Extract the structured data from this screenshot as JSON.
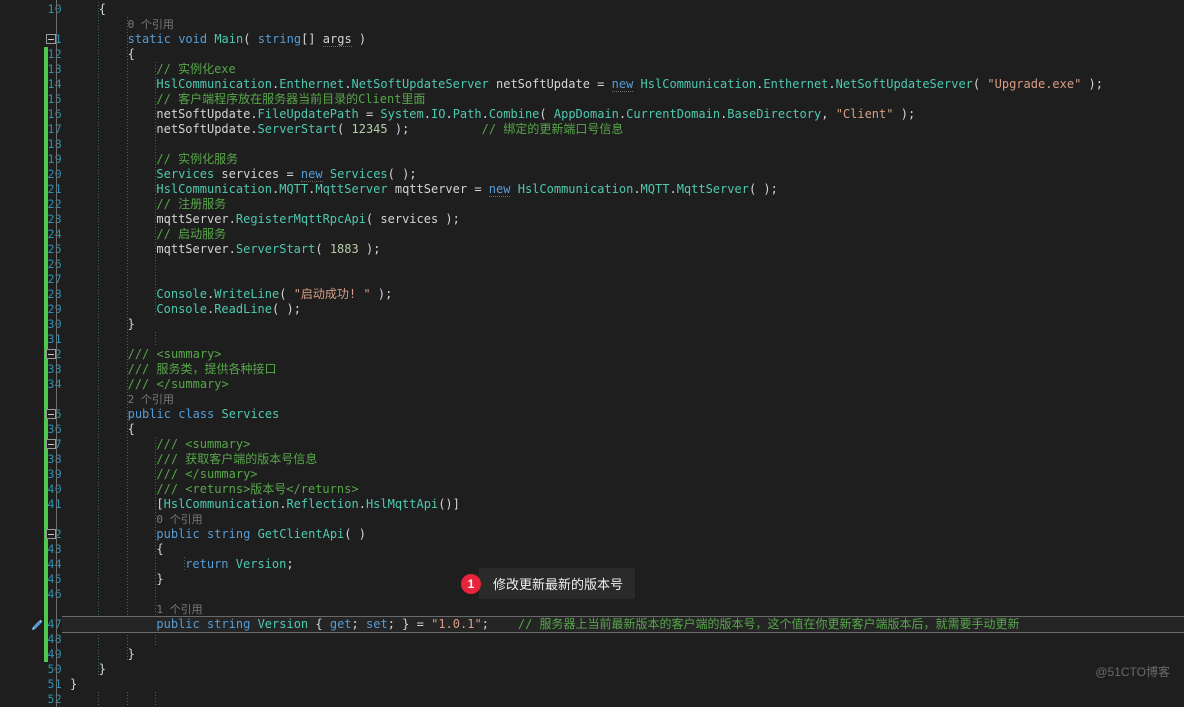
{
  "editor": {
    "name": "visual-studio-code-editor",
    "theme": "dark",
    "background_color": "#1e1e1e",
    "line_number_color": "#2b91af",
    "change_bar_color": "#4ec94e",
    "first_line": 10,
    "last_line": 52,
    "line_height": 15
  },
  "watermark": {
    "text": "@51CTO博客"
  },
  "annotation": {
    "badge": "1",
    "text": "修改更新最新的版本号"
  },
  "gutter": {
    "line_numbers": [
      10,
      11,
      12,
      13,
      14,
      15,
      16,
      17,
      18,
      19,
      20,
      21,
      22,
      23,
      24,
      25,
      26,
      27,
      28,
      29,
      30,
      31,
      32,
      33,
      34,
      35,
      36,
      37,
      38,
      39,
      40,
      41,
      42,
      43,
      44,
      45,
      46,
      47,
      48,
      49,
      50,
      51,
      52
    ],
    "fold_lines": [
      11,
      32,
      35,
      37,
      42
    ],
    "pencil_icon_line": 47
  },
  "code": {
    "lines": [
      {
        "n": 10,
        "indent": 4,
        "text": "{"
      },
      {
        "n": null,
        "indent": 8,
        "text": "0 个引用",
        "kind": "codelens"
      },
      {
        "n": 11,
        "indent": 8,
        "text": "static void Main( string[] args )"
      },
      {
        "n": 12,
        "indent": 8,
        "text": "{"
      },
      {
        "n": 13,
        "indent": 12,
        "text": "// 实例化exe"
      },
      {
        "n": 14,
        "indent": 12,
        "text": "HslCommunication.Enthernet.NetSoftUpdateServer netSoftUpdate = new HslCommunication.Enthernet.NetSoftUpdateServer( \"Upgrade.exe\" );"
      },
      {
        "n": 15,
        "indent": 12,
        "text": "// 客户端程序放在服务器当前目录的Client里面"
      },
      {
        "n": 16,
        "indent": 12,
        "text": "netSoftUpdate.FileUpdatePath = System.IO.Path.Combine( AppDomain.CurrentDomain.BaseDirectory, \"Client\" );"
      },
      {
        "n": 17,
        "indent": 12,
        "text": "netSoftUpdate.ServerStart( 12345 );          // 绑定的更新端口号信息"
      },
      {
        "n": 18,
        "indent": 12,
        "text": ""
      },
      {
        "n": 19,
        "indent": 12,
        "text": "// 实例化服务"
      },
      {
        "n": 20,
        "indent": 12,
        "text": "Services services = new Services( );"
      },
      {
        "n": 21,
        "indent": 12,
        "text": "HslCommunication.MQTT.MqttServer mqttServer = new HslCommunication.MQTT.MqttServer( );"
      },
      {
        "n": 22,
        "indent": 12,
        "text": "// 注册服务"
      },
      {
        "n": 23,
        "indent": 12,
        "text": "mqttServer.RegisterMqttRpcApi( services );"
      },
      {
        "n": 24,
        "indent": 12,
        "text": "// 启动服务"
      },
      {
        "n": 25,
        "indent": 12,
        "text": "mqttServer.ServerStart( 1883 );"
      },
      {
        "n": 26,
        "indent": 12,
        "text": ""
      },
      {
        "n": 27,
        "indent": 12,
        "text": ""
      },
      {
        "n": 28,
        "indent": 12,
        "text": "Console.WriteLine( \"启动成功! \" );"
      },
      {
        "n": 29,
        "indent": 12,
        "text": "Console.ReadLine( );"
      },
      {
        "n": 30,
        "indent": 8,
        "text": "}"
      },
      {
        "n": 31,
        "indent": 8,
        "text": ""
      },
      {
        "n": 32,
        "indent": 8,
        "text": "/// <summary>"
      },
      {
        "n": 33,
        "indent": 8,
        "text": "/// 服务类，提供各种接口"
      },
      {
        "n": 34,
        "indent": 8,
        "text": "/// </summary>"
      },
      {
        "n": null,
        "indent": 8,
        "text": "2 个引用",
        "kind": "codelens"
      },
      {
        "n": 35,
        "indent": 8,
        "text": "public class Services"
      },
      {
        "n": 36,
        "indent": 8,
        "text": "{"
      },
      {
        "n": 37,
        "indent": 12,
        "text": "/// <summary>"
      },
      {
        "n": 38,
        "indent": 12,
        "text": "/// 获取客户端的版本号信息"
      },
      {
        "n": 39,
        "indent": 12,
        "text": "/// </summary>"
      },
      {
        "n": 40,
        "indent": 12,
        "text": "/// <returns>版本号</returns>"
      },
      {
        "n": 41,
        "indent": 12,
        "text": "[HslCommunication.Reflection.HslMqttApi()]"
      },
      {
        "n": null,
        "indent": 12,
        "text": "0 个引用",
        "kind": "codelens"
      },
      {
        "n": 42,
        "indent": 12,
        "text": "public string GetClientApi( )"
      },
      {
        "n": 43,
        "indent": 12,
        "text": "{"
      },
      {
        "n": 44,
        "indent": 16,
        "text": "return Version;"
      },
      {
        "n": 45,
        "indent": 12,
        "text": "}"
      },
      {
        "n": 46,
        "indent": 12,
        "text": ""
      },
      {
        "n": null,
        "indent": 12,
        "text": "1 个引用",
        "kind": "codelens"
      },
      {
        "n": 47,
        "indent": 12,
        "text": "public string Version { get; set; } = \"1.0.1\";    // 服务器上当前最新版本的客户端的版本号，这个值在你更新客户端版本后，就需要手动更新"
      },
      {
        "n": 48,
        "indent": 12,
        "text": ""
      },
      {
        "n": 49,
        "indent": 8,
        "text": "}"
      },
      {
        "n": 50,
        "indent": 4,
        "text": "}"
      },
      {
        "n": 51,
        "indent": 0,
        "text": "}"
      },
      {
        "n": 52,
        "indent": 0,
        "text": ""
      }
    ]
  }
}
